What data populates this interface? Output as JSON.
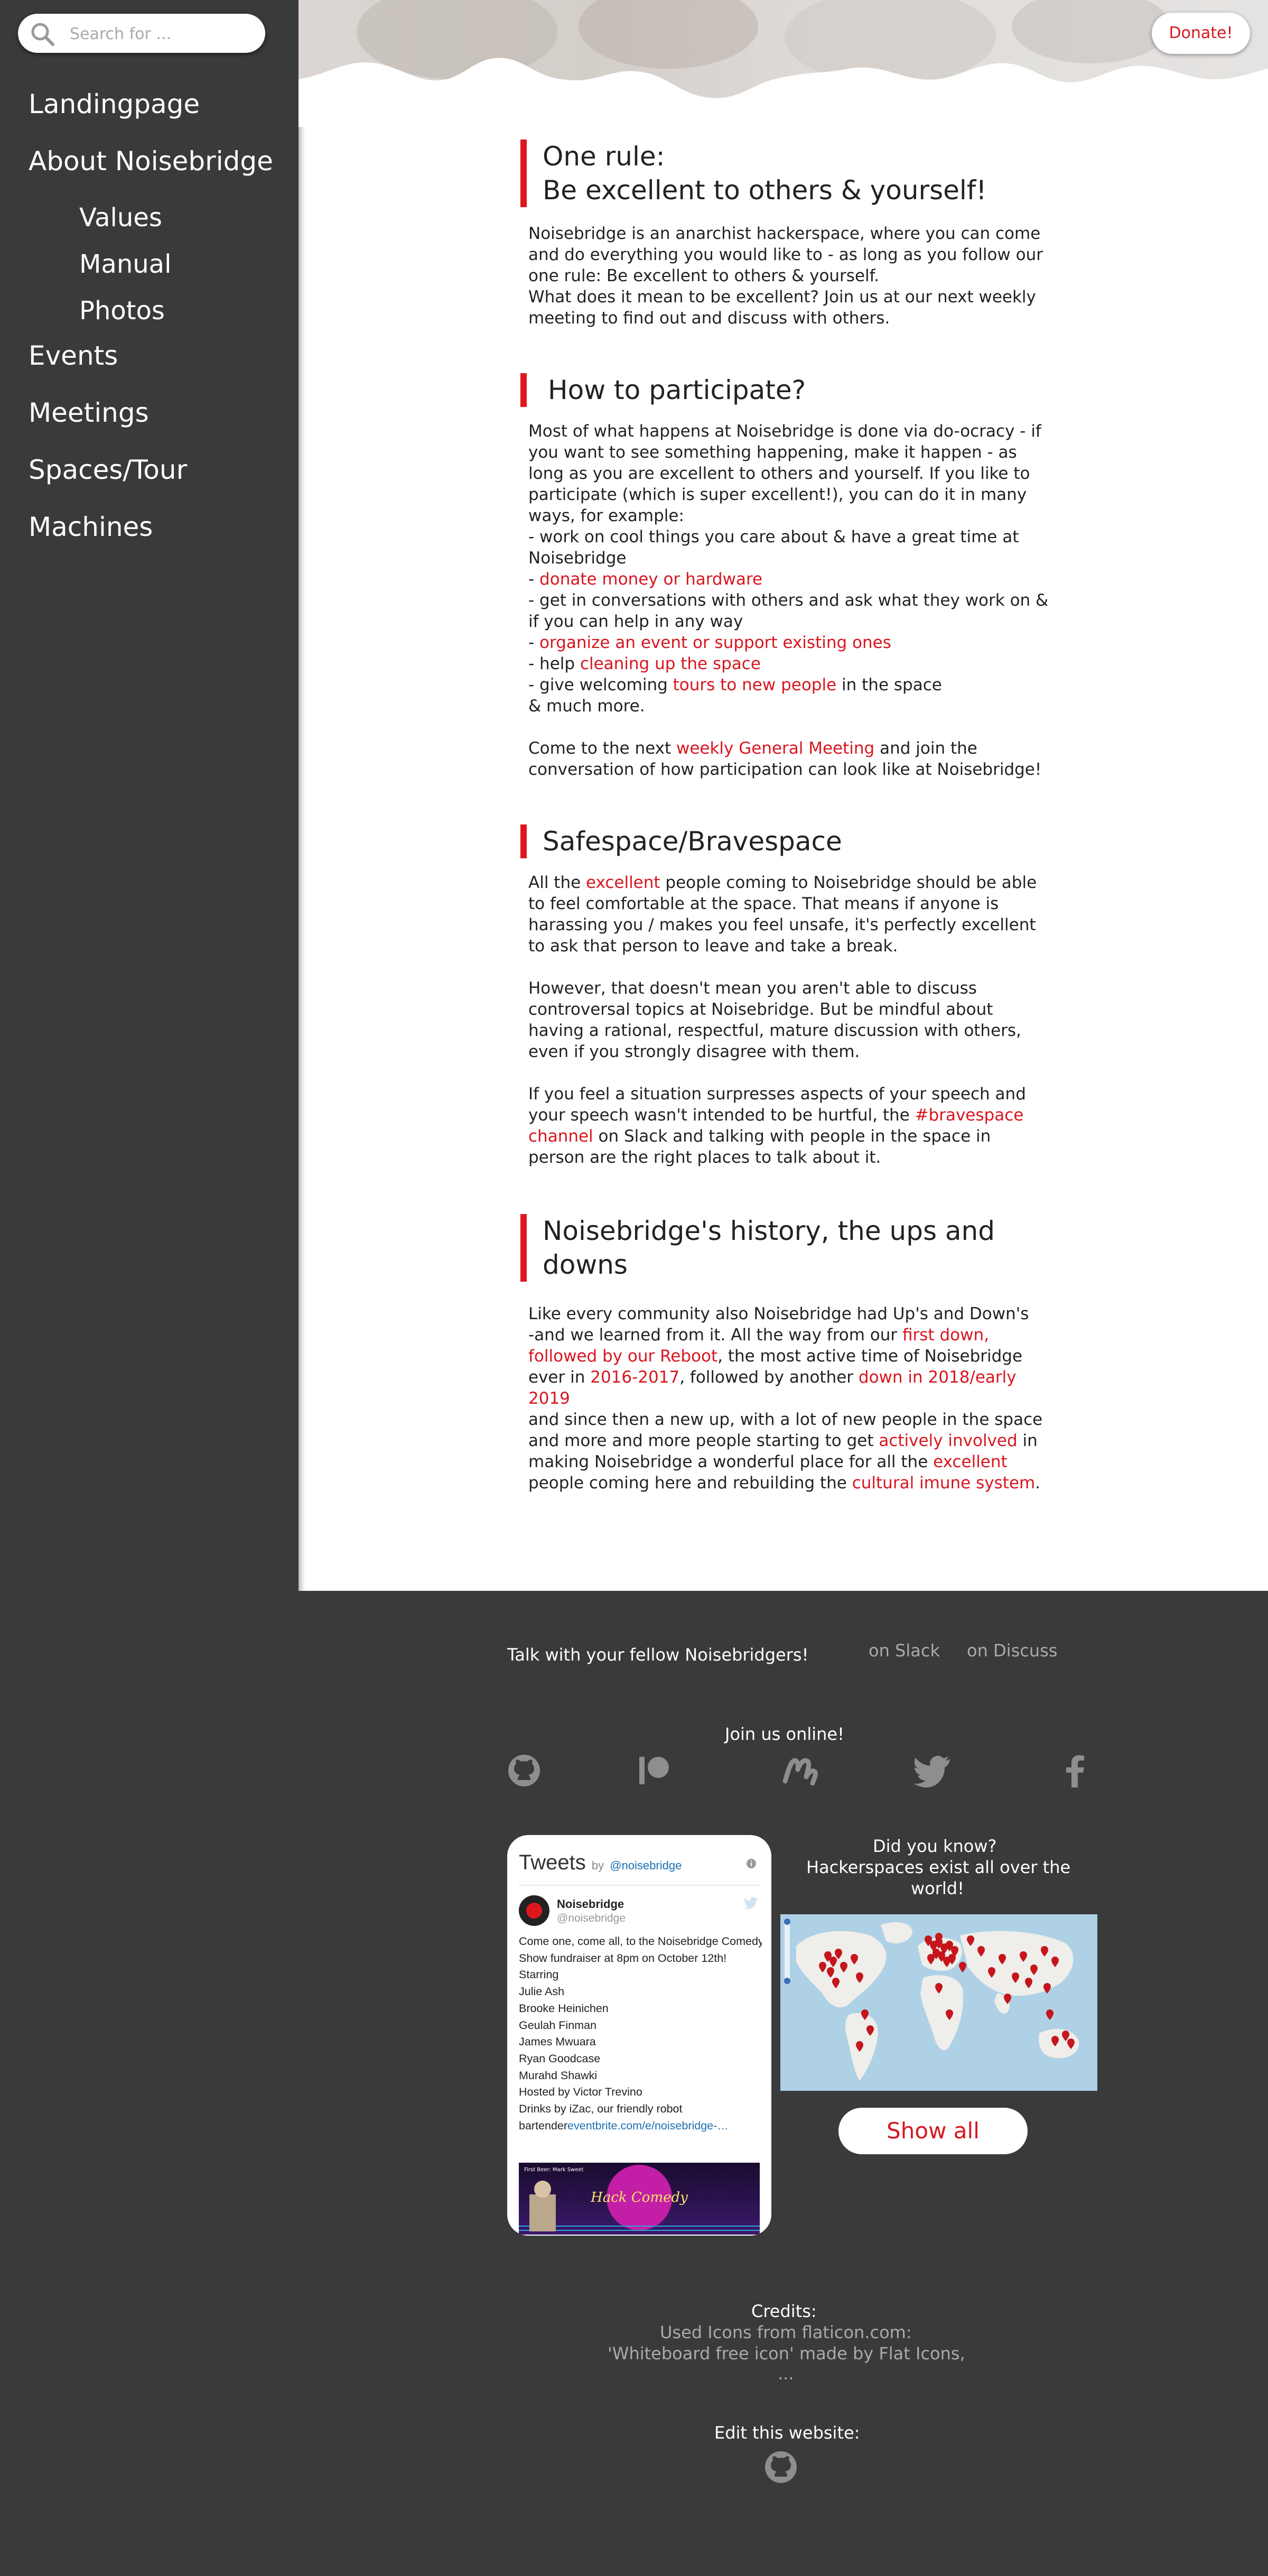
{
  "sidebar": {
    "search_placeholder": "Search for ...",
    "items": [
      {
        "label": "Landingpage"
      },
      {
        "label": "About Noisebridge"
      },
      {
        "label": "Values"
      },
      {
        "label": "Manual"
      },
      {
        "label": "Photos"
      },
      {
        "label": "Events"
      },
      {
        "label": "Meetings"
      },
      {
        "label": "Spaces/Tour"
      },
      {
        "label": "Machines"
      }
    ]
  },
  "header": {
    "donate_label": "Donate!"
  },
  "sections": {
    "rule": {
      "title_line1": "One rule:",
      "title_line2": "Be excellent to others & yourself!",
      "lines": [
        "Noisebridge is an anarchist hackerspace, where you can come",
        "and do everything you would like to - as long as you follow our",
        "one rule: Be excellent to others & yourself.",
        "What does it mean to be excellent? Join us at our next weekly",
        "meeting to find out and discuss with others."
      ]
    },
    "participate": {
      "title": "How to participate?",
      "intro": [
        "Most of what happens at Noisebridge is done via do-ocracy - if",
        "you want to see something happening, make it happen - as",
        "long as you are excellent to others and yourself. If you like to",
        "participate (which is super excellent!), you can do it in many",
        "ways, for example:",
        "- work on cool things you care about & have a great time at",
        "Noisebridge"
      ],
      "dash": "- ",
      "donate_link": "donate money or hardware",
      "conversations": [
        "- get in conversations with others and ask what they work on &",
        "if you can help in any way"
      ],
      "organize_link": "organize an event or support existing ones",
      "help_prefix": "- help ",
      "cleaning_link": "cleaning up the space",
      "welcome_prefix": "- give welcoming ",
      "tours_link": "tours to new people",
      "welcome_suffix": " in the space",
      "much_more": "& much more.",
      "come_prefix": "Come to the next ",
      "meeting_link": "weekly General Meeting",
      "come_suffix": " and join the",
      "come_line2": "conversation of how participation can look like at Noisebridge!"
    },
    "safespace": {
      "title": "Safespace/Bravespace",
      "p1_prefix": "All the ",
      "p1_link": "excellent",
      "p1_suffix": " people coming to Noisebridge should be able",
      "p1_lines": [
        "to feel comfortable at the space. That means if anyone is",
        "harassing you /  makes you feel unsafe, it's perfectly excellent",
        "to ask that person to leave and take a break."
      ],
      "p2_lines": [
        "However, that doesn't mean you aren't able to discuss",
        "controversal topics at Noisebridge. But be mindful about",
        "having a rational, respectful, mature discussion with others,",
        "even if you strongly disagree with them."
      ],
      "p3_line1": "If you feel a situation surpresses aspects of your speech and",
      "p3_prefix": "your speech wasn't intended to be hurtful, the ",
      "p3_link_a": "#bravespace",
      "p3_link_b": "channel",
      "p3_suffix": " on Slack and talking with people in the space in",
      "p3_line4": "person are the right places to talk about it."
    },
    "history": {
      "title_line1": "Noisebridge's history, the ups and",
      "title_line2": "downs",
      "l1": "Like every community also Noisebridge had Up's and Down's",
      "l2_prefix": "-and we learned from it. All the way from our ",
      "l2_link": "first down,",
      "l3_link": "followed by our Reboot",
      "l3_suffix": ", the most active time of Noisebridge",
      "l4_prefix": "ever in ",
      "l4_link1": "2016-2017",
      "l4_mid": ", followed by another ",
      "l4_link2": "down in 2018/early 2019",
      "l5": "and since then a new up, with a lot of new people in the space",
      "l6_prefix": "and more and more people starting to get ",
      "l6_link": "actively involved",
      "l6_suffix": " in",
      "l7_prefix": "making Noisebridge a wonderful place for all the ",
      "l7_link": "excellent",
      "l8_prefix": "people coming here and rebuilding the ",
      "l8_link": "cultural imune system",
      "l8_suffix": "."
    }
  },
  "footer": {
    "talk_label": "Talk with your fellow Noisebridgers!",
    "slack_link": "on Slack",
    "discuss_link": "on Discuss",
    "join_label": "Join us online!",
    "social_icons": [
      "github-icon",
      "patreon-icon",
      "meetup-icon",
      "twitter-icon",
      "facebook-icon"
    ],
    "tweets": {
      "title": "Tweets",
      "by": "by",
      "handle": "@noisebridge",
      "author_name": "Noisebridge",
      "author_handle": "@noisebridge",
      "body_lines": [
        "Come one, come all, to the Noisebridge Comedy",
        "Show fundraiser at 8pm on October 12th!",
        "Starring",
        "Julie Ash",
        "Brooke Heinichen",
        "Geulah Finman",
        "James Mwuara",
        "Ryan Goodcase",
        "Murahd Shawki",
        "Hosted by Victor Trevino",
        "Drinks by iZac, our friendly robot"
      ],
      "body_last_prefix": "bartender",
      "body_last_link": "eventbrite.com/e/noisebridge-…",
      "image_text": "Hack Comedy",
      "image_small_text": "First Beer: Mark Sweet"
    },
    "did_you_know": [
      "Did you know?",
      "Hackerspaces exist all over the",
      "world!"
    ],
    "show_all_label": "Show all",
    "credits_title": "Credits:",
    "credits_lines": [
      "Used Icons from flaticon.com:",
      "'Whiteboard free icon' made by Flat Icons,",
      "..."
    ],
    "edit_label": "Edit this website:",
    "colors": {
      "accent": "#d7161f",
      "footer_bg": "#3a3a3a",
      "sidebar_bg": "#3a3a3a"
    }
  }
}
